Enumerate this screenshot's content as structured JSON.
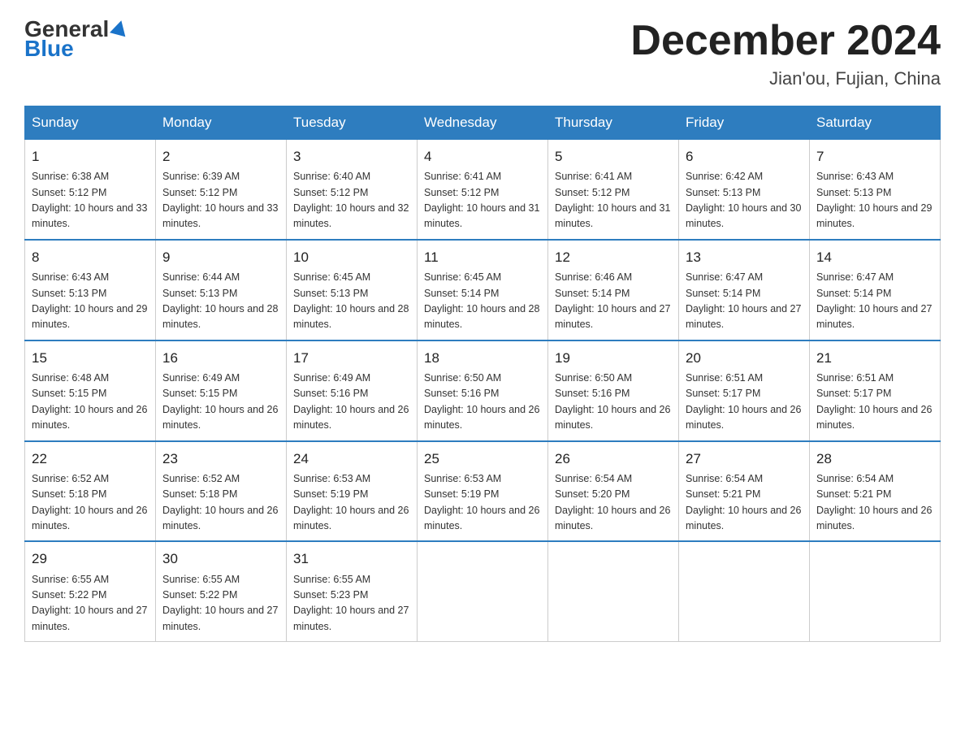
{
  "logo": {
    "general": "General",
    "blue": "Blue",
    "triangle_color": "#1a73c9"
  },
  "header": {
    "title": "December 2024",
    "subtitle": "Jian'ou, Fujian, China"
  },
  "days_of_week": [
    "Sunday",
    "Monday",
    "Tuesday",
    "Wednesday",
    "Thursday",
    "Friday",
    "Saturday"
  ],
  "weeks": [
    [
      {
        "day": "1",
        "sunrise": "6:38 AM",
        "sunset": "5:12 PM",
        "daylight": "10 hours and 33 minutes."
      },
      {
        "day": "2",
        "sunrise": "6:39 AM",
        "sunset": "5:12 PM",
        "daylight": "10 hours and 33 minutes."
      },
      {
        "day": "3",
        "sunrise": "6:40 AM",
        "sunset": "5:12 PM",
        "daylight": "10 hours and 32 minutes."
      },
      {
        "day": "4",
        "sunrise": "6:41 AM",
        "sunset": "5:12 PM",
        "daylight": "10 hours and 31 minutes."
      },
      {
        "day": "5",
        "sunrise": "6:41 AM",
        "sunset": "5:12 PM",
        "daylight": "10 hours and 31 minutes."
      },
      {
        "day": "6",
        "sunrise": "6:42 AM",
        "sunset": "5:13 PM",
        "daylight": "10 hours and 30 minutes."
      },
      {
        "day": "7",
        "sunrise": "6:43 AM",
        "sunset": "5:13 PM",
        "daylight": "10 hours and 29 minutes."
      }
    ],
    [
      {
        "day": "8",
        "sunrise": "6:43 AM",
        "sunset": "5:13 PM",
        "daylight": "10 hours and 29 minutes."
      },
      {
        "day": "9",
        "sunrise": "6:44 AM",
        "sunset": "5:13 PM",
        "daylight": "10 hours and 28 minutes."
      },
      {
        "day": "10",
        "sunrise": "6:45 AM",
        "sunset": "5:13 PM",
        "daylight": "10 hours and 28 minutes."
      },
      {
        "day": "11",
        "sunrise": "6:45 AM",
        "sunset": "5:14 PM",
        "daylight": "10 hours and 28 minutes."
      },
      {
        "day": "12",
        "sunrise": "6:46 AM",
        "sunset": "5:14 PM",
        "daylight": "10 hours and 27 minutes."
      },
      {
        "day": "13",
        "sunrise": "6:47 AM",
        "sunset": "5:14 PM",
        "daylight": "10 hours and 27 minutes."
      },
      {
        "day": "14",
        "sunrise": "6:47 AM",
        "sunset": "5:14 PM",
        "daylight": "10 hours and 27 minutes."
      }
    ],
    [
      {
        "day": "15",
        "sunrise": "6:48 AM",
        "sunset": "5:15 PM",
        "daylight": "10 hours and 26 minutes."
      },
      {
        "day": "16",
        "sunrise": "6:49 AM",
        "sunset": "5:15 PM",
        "daylight": "10 hours and 26 minutes."
      },
      {
        "day": "17",
        "sunrise": "6:49 AM",
        "sunset": "5:16 PM",
        "daylight": "10 hours and 26 minutes."
      },
      {
        "day": "18",
        "sunrise": "6:50 AM",
        "sunset": "5:16 PM",
        "daylight": "10 hours and 26 minutes."
      },
      {
        "day": "19",
        "sunrise": "6:50 AM",
        "sunset": "5:16 PM",
        "daylight": "10 hours and 26 minutes."
      },
      {
        "day": "20",
        "sunrise": "6:51 AM",
        "sunset": "5:17 PM",
        "daylight": "10 hours and 26 minutes."
      },
      {
        "day": "21",
        "sunrise": "6:51 AM",
        "sunset": "5:17 PM",
        "daylight": "10 hours and 26 minutes."
      }
    ],
    [
      {
        "day": "22",
        "sunrise": "6:52 AM",
        "sunset": "5:18 PM",
        "daylight": "10 hours and 26 minutes."
      },
      {
        "day": "23",
        "sunrise": "6:52 AM",
        "sunset": "5:18 PM",
        "daylight": "10 hours and 26 minutes."
      },
      {
        "day": "24",
        "sunrise": "6:53 AM",
        "sunset": "5:19 PM",
        "daylight": "10 hours and 26 minutes."
      },
      {
        "day": "25",
        "sunrise": "6:53 AM",
        "sunset": "5:19 PM",
        "daylight": "10 hours and 26 minutes."
      },
      {
        "day": "26",
        "sunrise": "6:54 AM",
        "sunset": "5:20 PM",
        "daylight": "10 hours and 26 minutes."
      },
      {
        "day": "27",
        "sunrise": "6:54 AM",
        "sunset": "5:21 PM",
        "daylight": "10 hours and 26 minutes."
      },
      {
        "day": "28",
        "sunrise": "6:54 AM",
        "sunset": "5:21 PM",
        "daylight": "10 hours and 26 minutes."
      }
    ],
    [
      {
        "day": "29",
        "sunrise": "6:55 AM",
        "sunset": "5:22 PM",
        "daylight": "10 hours and 27 minutes."
      },
      {
        "day": "30",
        "sunrise": "6:55 AM",
        "sunset": "5:22 PM",
        "daylight": "10 hours and 27 minutes."
      },
      {
        "day": "31",
        "sunrise": "6:55 AM",
        "sunset": "5:23 PM",
        "daylight": "10 hours and 27 minutes."
      },
      null,
      null,
      null,
      null
    ]
  ]
}
